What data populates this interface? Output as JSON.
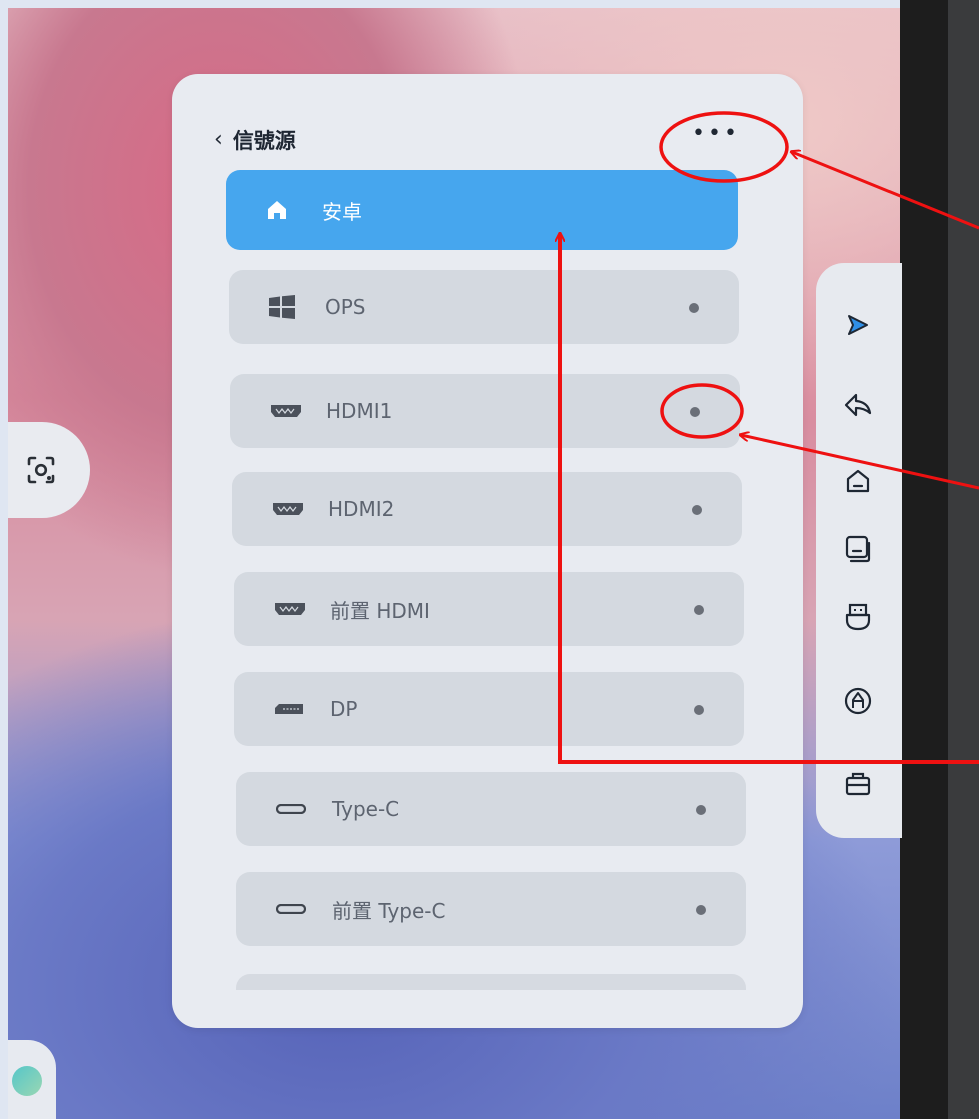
{
  "panel": {
    "title": "信號源",
    "back_icon": "chevron-left-icon",
    "more_icon": "more-horizontal-icon"
  },
  "sources": [
    {
      "label": "安卓",
      "icon": "home-icon",
      "active": true
    },
    {
      "label": "OPS",
      "icon": "windows-icon",
      "active": false
    },
    {
      "label": "HDMI1",
      "icon": "hdmi-port-icon",
      "active": false
    },
    {
      "label": "HDMI2",
      "icon": "hdmi-port-icon",
      "active": false
    },
    {
      "label": "前置 HDMI",
      "icon": "hdmi-port-icon",
      "active": false
    },
    {
      "label": "DP",
      "icon": "displayport-icon",
      "active": false
    },
    {
      "label": "Type-C",
      "icon": "usb-c-icon",
      "active": false
    },
    {
      "label": "前置 Type-C",
      "icon": "usb-c-icon",
      "active": false
    }
  ],
  "toolbar": {
    "tools": [
      "play-icon",
      "back-icon",
      "home-icon",
      "window-icon",
      "usb-icon",
      "pen-icon",
      "toolbox-icon"
    ]
  },
  "side_widgets": {
    "left": "screenshot-lens-icon"
  },
  "colors": {
    "accent": "#46a6ee",
    "annotation": "#ee1111",
    "panel": "#e8ebf1",
    "item": "#d4d9e0"
  }
}
